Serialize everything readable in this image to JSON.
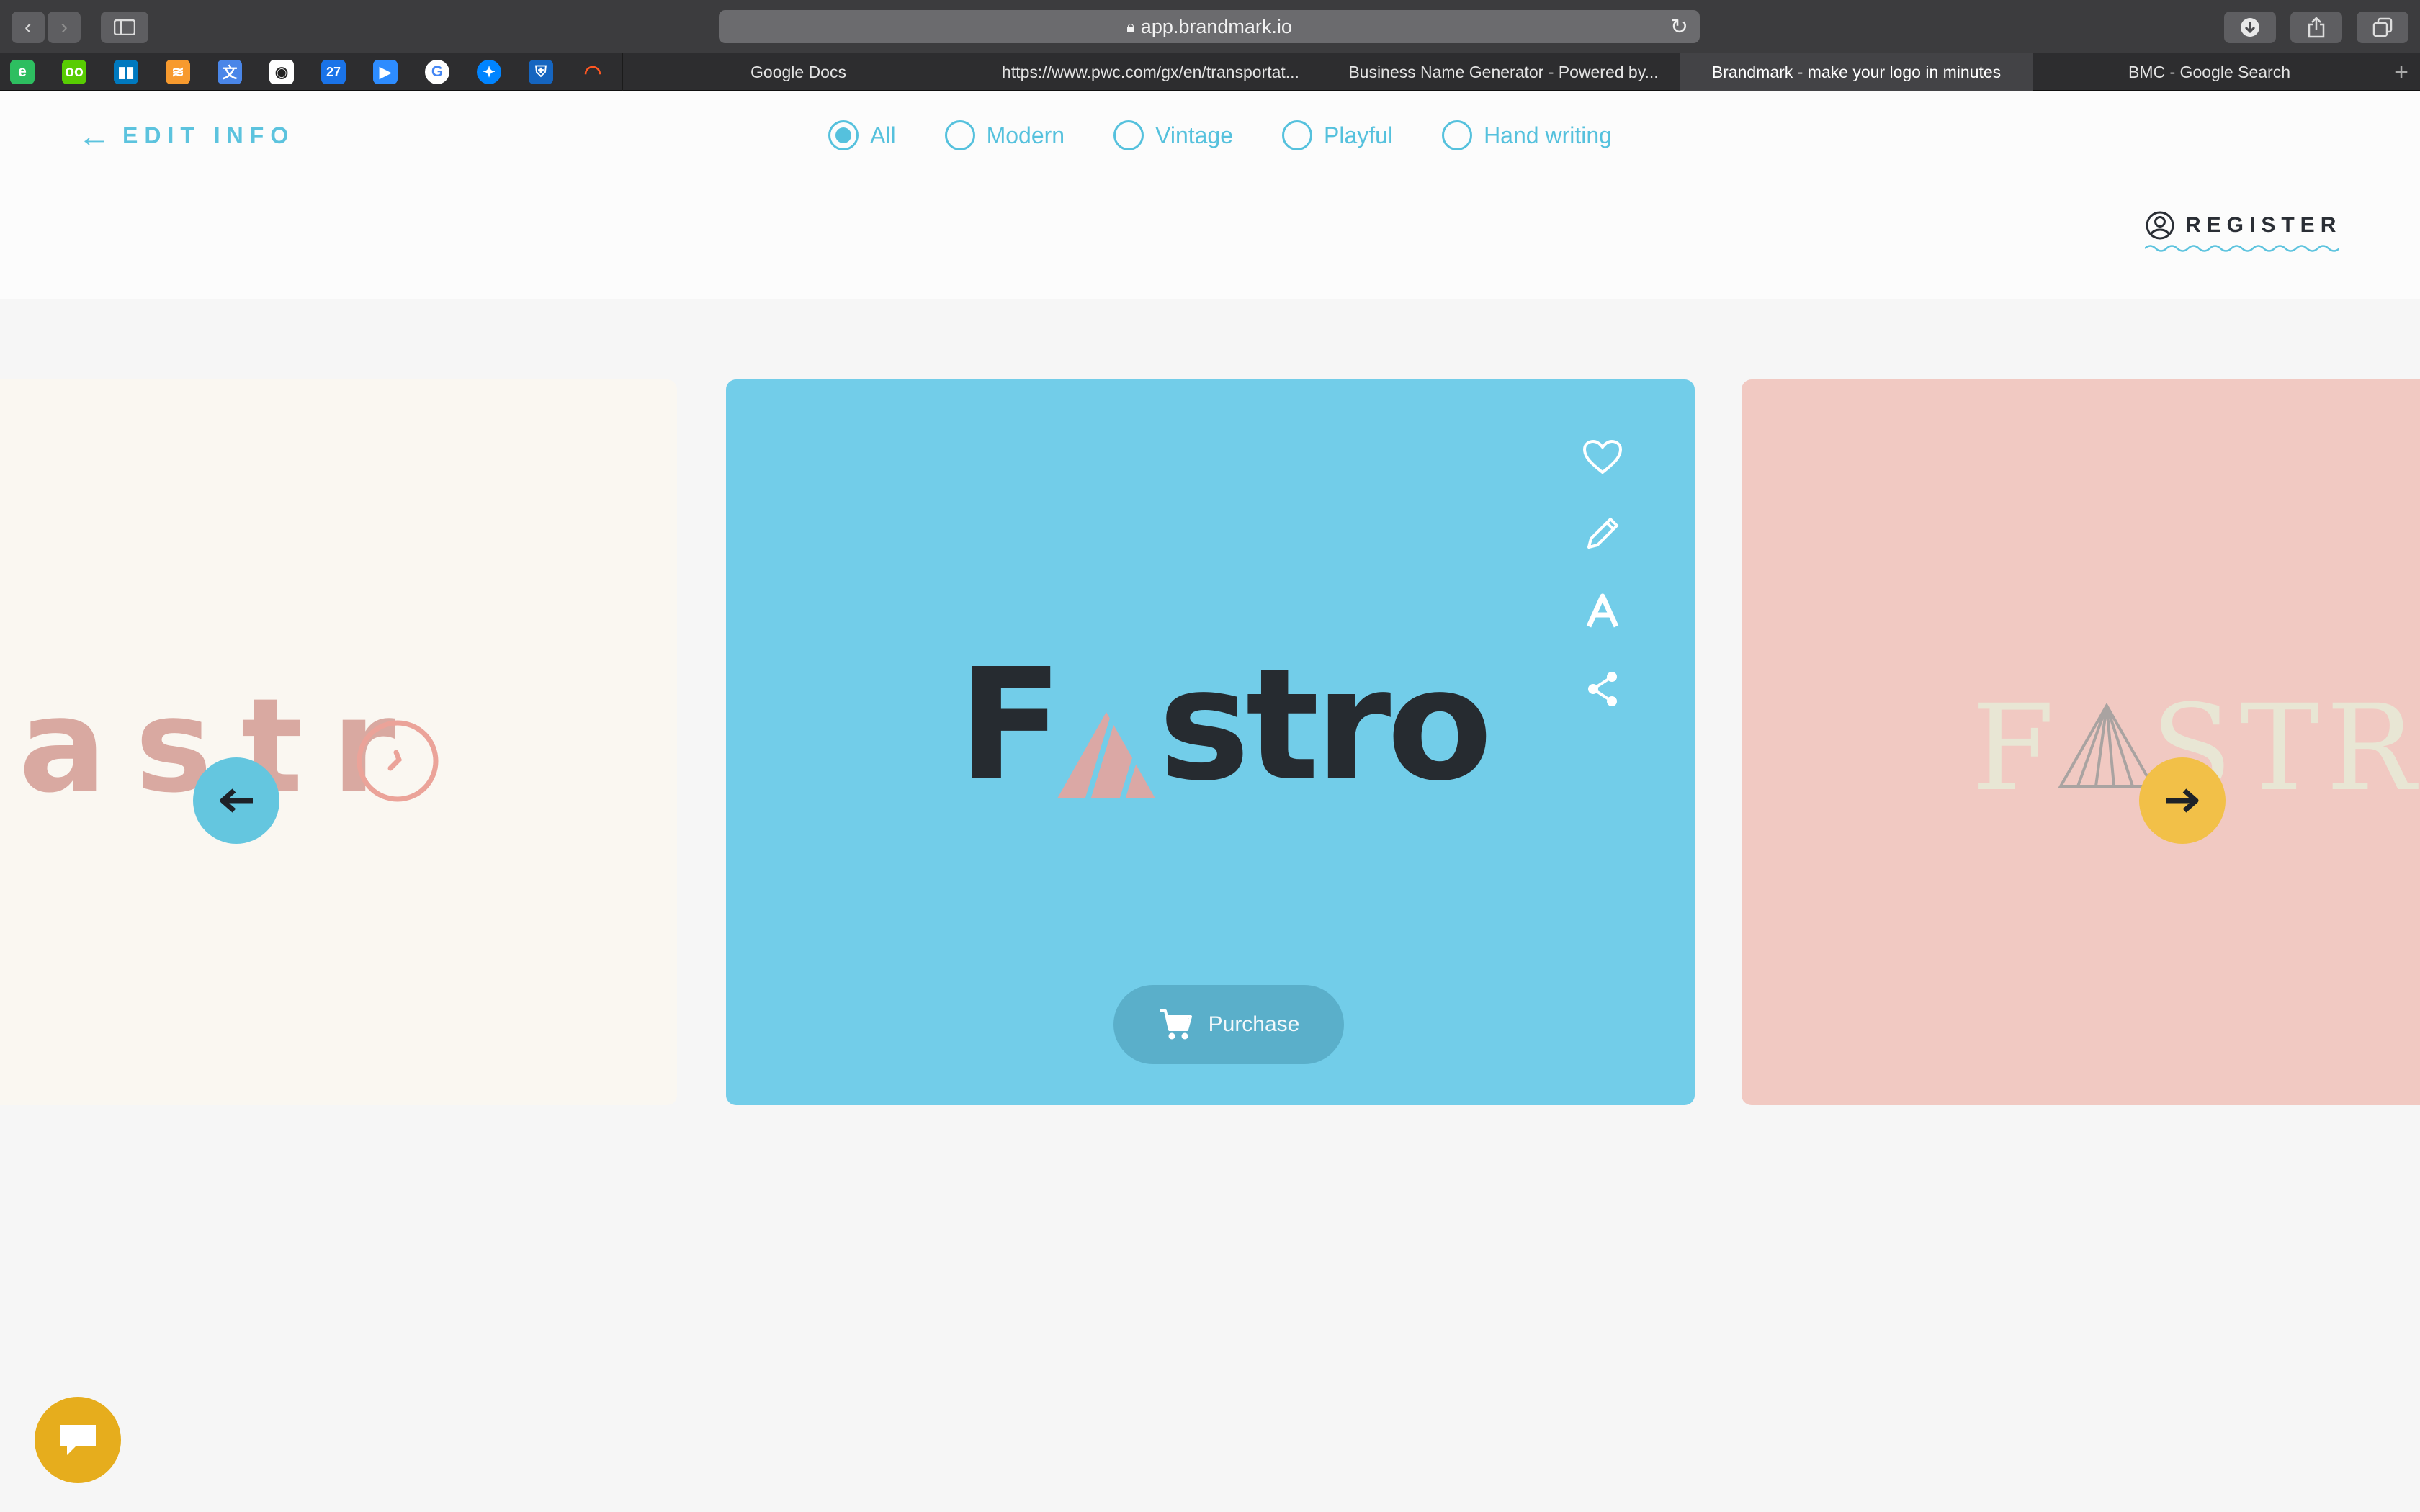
{
  "browser": {
    "url": "app.brandmark.io",
    "tabs": [
      {
        "title": "Google Docs",
        "active": false
      },
      {
        "title": "https://www.pwc.com/gx/en/transportat...",
        "active": false
      },
      {
        "title": "Business Name Generator - Powered by...",
        "active": false
      },
      {
        "title": "Brandmark - make your logo in minutes",
        "active": true
      },
      {
        "title": "BMC - Google Search",
        "active": false
      }
    ],
    "favorites": [
      {
        "icon": "evernote-icon",
        "glyph": "e",
        "color": "#2dbe60"
      },
      {
        "icon": "duolingo-icon",
        "glyph": "oo",
        "color": "#58cc02"
      },
      {
        "icon": "trello-icon",
        "glyph": "▮▮",
        "color": "#0079bf"
      },
      {
        "icon": "sublime-icon",
        "glyph": "≋",
        "color": "#f79a2e"
      },
      {
        "icon": "translate-icon",
        "glyph": "文",
        "color": "#4a86e8"
      },
      {
        "icon": "github-icon",
        "glyph": "◉",
        "color": "#ffffff"
      },
      {
        "icon": "calendar-icon",
        "glyph": "27",
        "color": "#1a73e8"
      },
      {
        "icon": "zoom-icon",
        "glyph": "▶",
        "color": "#2d8cff"
      },
      {
        "icon": "google-icon",
        "glyph": "G",
        "color": "#ffffff"
      },
      {
        "icon": "messenger-icon",
        "glyph": "✦",
        "color": "#0084ff"
      },
      {
        "icon": "shield-bookmark-icon",
        "glyph": "⛨",
        "color": "#1565c0"
      },
      {
        "icon": "orbit-icon",
        "glyph": "◠",
        "color": "#ff5722"
      }
    ]
  },
  "header": {
    "back_label": "EDIT INFO",
    "register_label": "REGISTER",
    "filters": [
      {
        "label": "All",
        "selected": true
      },
      {
        "label": "Modern",
        "selected": false
      },
      {
        "label": "Vintage",
        "selected": false
      },
      {
        "label": "Playful",
        "selected": false
      },
      {
        "label": "Hand writing",
        "selected": false
      }
    ]
  },
  "carousel": {
    "left_logo_text": "astr",
    "center_logo": {
      "first": "F",
      "rest": "stro"
    },
    "right_logo": {
      "first": "F",
      "rest": "STRO"
    },
    "purchase_label": "Purchase",
    "colors": {
      "accent": "#5cc3de",
      "center_bg": "#72cde9",
      "left_bg": "#faf7f1",
      "right_bg": "#f1c9c2",
      "next_button": "#f2c048",
      "chat_button": "#e6ad1d"
    },
    "card_actions": [
      "heart-icon",
      "pencil-icon",
      "font-icon",
      "share-icon"
    ]
  }
}
